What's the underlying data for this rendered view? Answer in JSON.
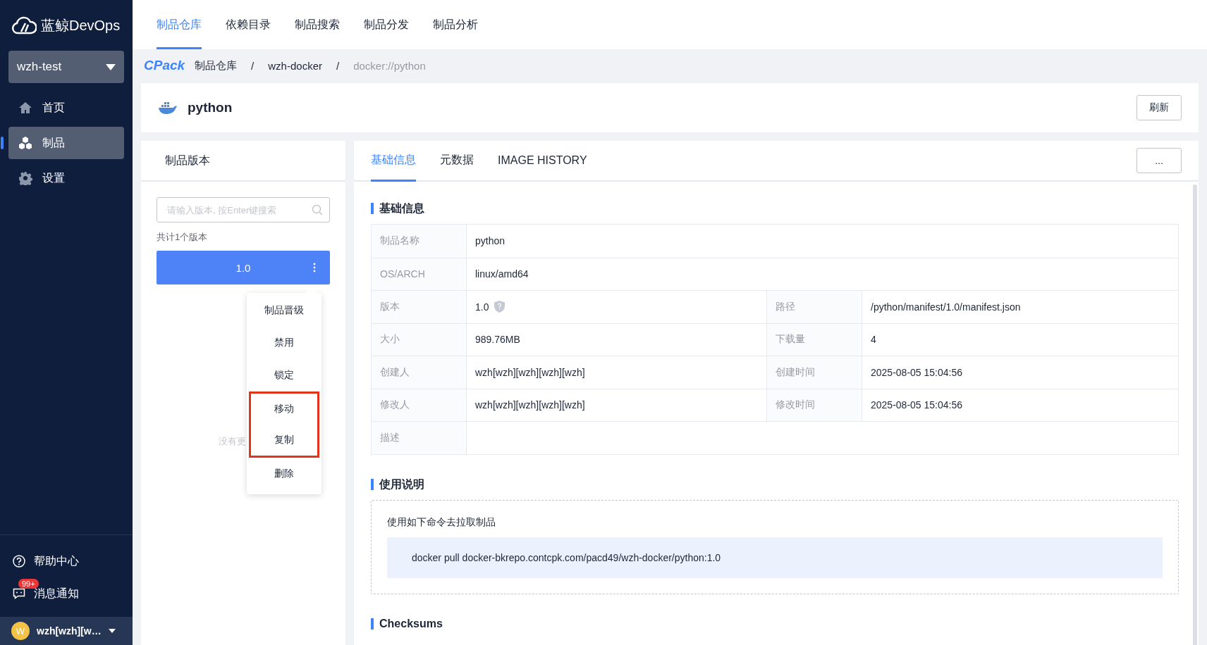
{
  "sidebar": {
    "logo": "蓝鲸DevOps",
    "project": "wzh-test",
    "nav": [
      {
        "label": "首页",
        "kind": "home",
        "selected": false
      },
      {
        "label": "制品",
        "kind": "cubes",
        "selected": true
      },
      {
        "label": "设置",
        "kind": "gear",
        "selected": false
      }
    ],
    "footer": [
      {
        "label": "帮助中心",
        "kind": "help"
      },
      {
        "label": "消息通知",
        "kind": "message",
        "badge": "99+"
      }
    ],
    "user": {
      "avatar": "W",
      "name": "wzh[wzh][w…"
    }
  },
  "top_tabs": [
    {
      "label": "制品仓库",
      "selected": true
    },
    {
      "label": "依赖目录",
      "selected": false
    },
    {
      "label": "制品搜索",
      "selected": false
    },
    {
      "label": "制品分发",
      "selected": false
    },
    {
      "label": "制品分析",
      "selected": false
    }
  ],
  "breadcrumb": {
    "brand": "CPack",
    "items": [
      {
        "label": "制品仓库",
        "current": false
      },
      {
        "label": "wzh-docker",
        "current": false
      },
      {
        "label": "docker://python",
        "current": true
      }
    ],
    "separator": "/"
  },
  "header": {
    "title": "python",
    "button": "刷新"
  },
  "versions_panel": {
    "title": "制品版本",
    "search_placeholder": "请输入版本, 按Enter键搜索",
    "count": "共计1个版本",
    "versions": [
      {
        "label": "1.0",
        "selected": true
      }
    ],
    "more_text": "没有更"
  },
  "context_menu": [
    {
      "label": "制品晋级",
      "highlighted": false
    },
    {
      "label": "禁用",
      "highlighted": false
    },
    {
      "label": "锁定",
      "highlighted": false
    },
    {
      "label": "移动",
      "highlighted": true
    },
    {
      "label": "复制",
      "highlighted": true
    },
    {
      "label": "删除",
      "highlighted": false
    }
  ],
  "detail_tabs": [
    {
      "label": "基础信息",
      "selected": true
    },
    {
      "label": "元数据",
      "selected": false
    },
    {
      "label": "IMAGE HISTORY",
      "selected": false
    }
  ],
  "more_button": "...",
  "basic_info": {
    "title": "基础信息",
    "rows": [
      {
        "cells": [
          {
            "label": "制品名称",
            "value": "python"
          }
        ]
      },
      {
        "cells": [
          {
            "label": "OS/ARCH",
            "value": "linux/amd64"
          }
        ]
      },
      {
        "cells": [
          {
            "label": "版本",
            "value": "1.0",
            "shield": true
          },
          {
            "label": "路径",
            "value": "/python/manifest/1.0/manifest.json"
          }
        ]
      },
      {
        "cells": [
          {
            "label": "大小",
            "value": "989.76MB"
          },
          {
            "label": "下载量",
            "value": "4"
          }
        ]
      },
      {
        "cells": [
          {
            "label": "创建人",
            "value": "wzh[wzh][wzh][wzh][wzh]"
          },
          {
            "label": "创建时间",
            "value": "2025-08-05 15:04:56"
          }
        ]
      },
      {
        "cells": [
          {
            "label": "修改人",
            "value": "wzh[wzh][wzh][wzh][wzh]"
          },
          {
            "label": "修改时间",
            "value": "2025-08-05 15:04:56"
          }
        ]
      },
      {
        "cells": [
          {
            "label": "描述"
          }
        ]
      }
    ]
  },
  "usage": {
    "title": "使用说明",
    "intro": "使用如下命令去拉取制品",
    "command": "docker pull docker-bkrepo.contcpk.com/pacd49/wzh-docker/python:1.0"
  },
  "checksums": {
    "title": "Checksums"
  }
}
